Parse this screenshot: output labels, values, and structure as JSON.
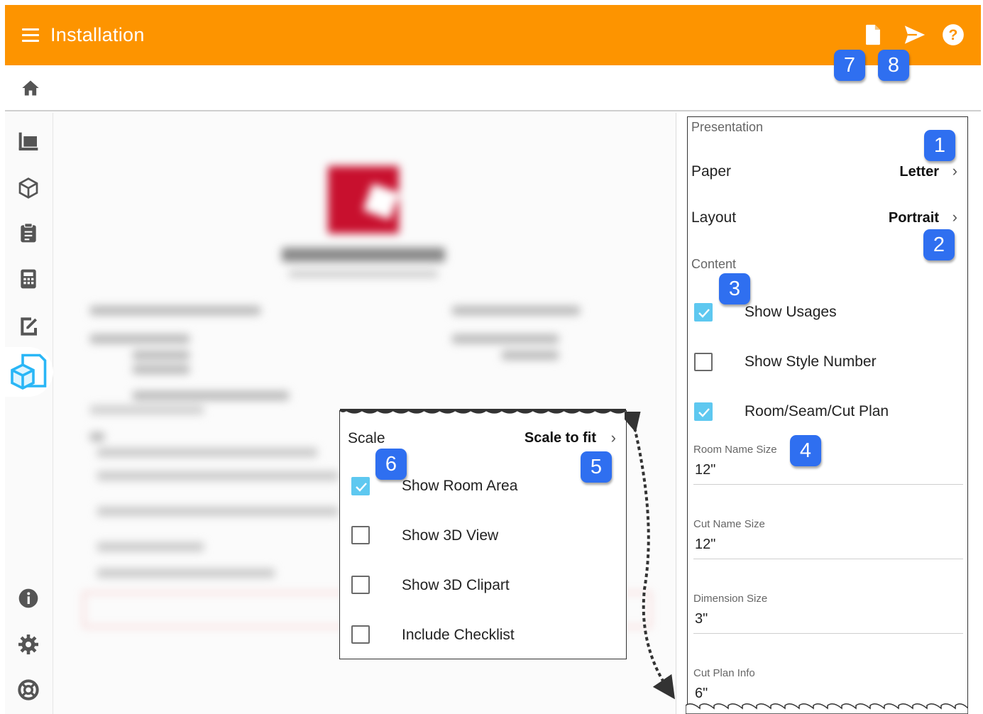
{
  "app": {
    "title": "Installation"
  },
  "toolbar": {
    "icons": [
      "document-icon",
      "send-icon",
      "help-icon"
    ]
  },
  "sidebar": {
    "icons": [
      "layers-icon",
      "cube-icon",
      "clipboard-icon",
      "calculator-icon",
      "edit-document-icon",
      "installation-icon",
      "info-icon",
      "settings-icon",
      "support-icon"
    ]
  },
  "panel": {
    "presentation_title": "Presentation",
    "paper": {
      "label": "Paper",
      "value": "Letter"
    },
    "layout": {
      "label": "Layout",
      "value": "Portrait"
    },
    "content_title": "Content",
    "options": [
      {
        "label": "Show Usages",
        "checked": true
      },
      {
        "label": "Show Style Number",
        "checked": false
      },
      {
        "label": "Room/Seam/Cut Plan",
        "checked": true
      }
    ],
    "fields": [
      {
        "label": "Room Name Size",
        "value": "12\""
      },
      {
        "label": "Cut Name Size",
        "value": "12\""
      },
      {
        "label": "Dimension Size",
        "value": "3\""
      },
      {
        "label": "Cut Plan Info",
        "value": "6\""
      }
    ]
  },
  "popup": {
    "scale": {
      "label": "Scale",
      "value": "Scale to fit"
    },
    "options": [
      {
        "label": "Show Room Area",
        "checked": true
      },
      {
        "label": "Show 3D View",
        "checked": false
      },
      {
        "label": "Show 3D Clipart",
        "checked": false
      },
      {
        "label": "Include Checklist",
        "checked": false
      }
    ]
  },
  "badges": [
    "1",
    "2",
    "3",
    "4",
    "5",
    "6",
    "7",
    "8"
  ],
  "colors": {
    "topbar": "#fd9400",
    "badge": "#2f6ff0",
    "checkbox": "#5ec8f0"
  }
}
